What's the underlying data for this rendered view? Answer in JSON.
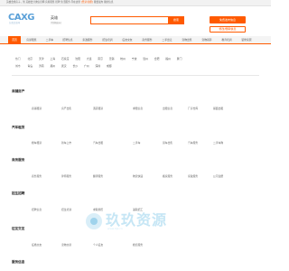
{
  "topbar": {
    "text": "英雄会找房子，到 英雄会分类信息网 房屋租售 招聘 生活服务 尽在这里",
    "link": "[登录/注册]",
    "suffix": "我要发布 我的信息"
  },
  "header": {
    "logo": "CAXG",
    "logo_sub": "分类信息网",
    "city": "英雄",
    "city_sub": "[切换城市]",
    "search_placeholder": "",
    "search_button": "搜索",
    "post_button": "免费发布信息",
    "manage_button": "修改/删除信息"
  },
  "nav": {
    "items": [
      "首页",
      "房屋租售",
      "二手车",
      "招聘信息",
      "家政服务",
      "招生培训",
      "征友交友",
      "商务服务",
      "二手出让",
      "宠物出售",
      "宠物领养",
      "教育培训",
      "装修家居"
    ]
  },
  "cities": {
    "row1_label": "热门",
    "row1": [
      "北京",
      "天津",
      "上海",
      "石家庄",
      "沈阳",
      "大连",
      "南京",
      "无锡",
      "杭州",
      "宁波",
      "温州",
      "合肥",
      "福州",
      "厦门"
    ],
    "row2_label": "城市",
    "row2": [
      "青岛",
      "济南",
      "郑州",
      "武汉",
      "长沙",
      "广州",
      "深圳",
      "成都"
    ]
  },
  "categories": [
    {
      "title": "商铺房产",
      "items": [
        "商铺租赁",
        "房产出售",
        "酒店租赁",
        "求租信息",
        "出租信息",
        "厂房仓库",
        "铺面出租"
      ]
    },
    {
      "title": "汽车租赁",
      "items": [
        "婚车租赁",
        "新车上市",
        "汽车出租",
        "二手车",
        "货车出售",
        "汽车服务",
        "二手车购"
      ]
    },
    {
      "title": "商务服务",
      "items": [
        "商务服务",
        "律师服务",
        "翻译服务",
        "物流快递",
        "搬家服务",
        "家政服务",
        "公司注册"
      ]
    },
    {
      "title": "招生招聘",
      "items": [
        "招聘信息",
        "招生培训",
        "求职简历",
        "兼职招工"
      ]
    },
    {
      "title": "征友交友",
      "items": [
        "征婚交友",
        "宠物交易",
        "个人征友",
        "婚恋服务"
      ]
    },
    {
      "title": "服务信息",
      "items": []
    }
  ],
  "watermark": {
    "text": "玖玖资源",
    "sub": "www.9jz.cn"
  },
  "colors": {
    "accent": "#ff5a00",
    "nav_bg": "#f4f4f4",
    "logo": "#5aa0d8"
  }
}
